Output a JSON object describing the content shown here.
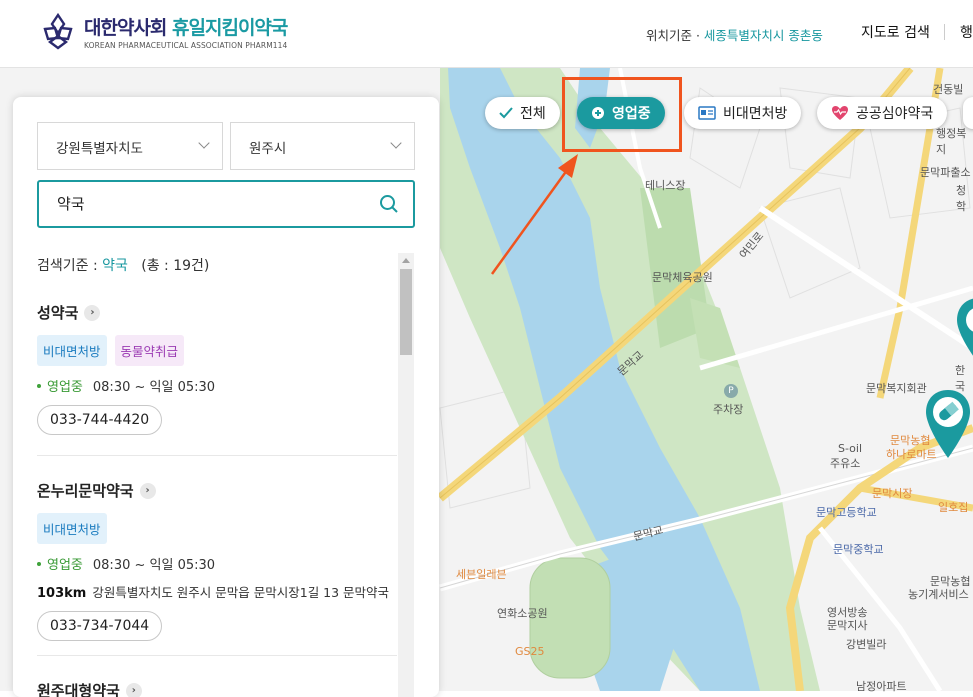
{
  "header": {
    "logo_title_main": "대한약사회",
    "logo_title_accent": "휴일지킴이약국",
    "logo_subtitle": "KOREAN PHARMACEUTICAL ASSOCIATION PHARM114",
    "location_prefix": "위치기준 · ",
    "location_value": "세종특별자치시 종촌동",
    "nav_map_search": "지도로 검색",
    "nav_more": "행"
  },
  "filters": [
    {
      "label": "전체",
      "icon": "check-icon",
      "active": false
    },
    {
      "label": "영업중",
      "icon": "plus-circle-icon",
      "active": true
    },
    {
      "label": "비대면처방",
      "icon": "id-card-icon",
      "active": false
    },
    {
      "label": "공공심야약국",
      "icon": "heart-pulse-icon",
      "active": false
    }
  ],
  "panel": {
    "province": "강원특별자치도",
    "city": "원주시",
    "search_value": "약국",
    "criteria_prefix": "검색기준 : ",
    "criteria_keyword": "약국",
    "criteria_count": "(총 : 19건)"
  },
  "pharmacies": [
    {
      "name": "성약국",
      "tags": [
        "비대면처방",
        "동물약취급"
      ],
      "status": "영업중",
      "hours": "08:30 ~ 익일 05:30",
      "distance": "",
      "address": "",
      "phone": "033-744-4420"
    },
    {
      "name": "온누리문막약국",
      "tags": [
        "비대면처방"
      ],
      "status": "영업중",
      "hours": "08:30 ~ 익일 05:30",
      "distance": "103km",
      "address": "강원특별자치도 원주시 문막읍 문막시장1길 13 문막약국",
      "phone": "033-734-7044"
    },
    {
      "name": "원주대형약국",
      "tags": [],
      "status": "",
      "hours": "",
      "distance": "",
      "address": "",
      "phone": ""
    }
  ],
  "map_labels": {
    "tennis": "테니스장",
    "park": "문막체육공원",
    "parking": "주차장",
    "bridge1": "문막교",
    "bridge2": "문막교",
    "road": "여민로",
    "welfare": "문막복지회관",
    "nonghyup": "문막농협",
    "hana": "하나로마트",
    "soil": "S-oil",
    "gas": "주유소",
    "market": "문막시장",
    "highschool": "문막고등학교",
    "middleschool": "문막중학교",
    "ilho": "일호집",
    "seven": "세븐일레븐",
    "yeonhwa": "연화소공원",
    "gs25": "GS25",
    "broadcast": "영서방송",
    "broadcast2": "문막지사",
    "gangbyeon": "강변빌라",
    "namjung": "남정아파트",
    "nonghyup2": "문막농협",
    "nongki": "농기계서비스",
    "geondong": "건동빌",
    "haengjeong": "행정복지",
    "culture": "문막파출소",
    "cheong": "청학",
    "han": "한국",
    "num25": "25"
  }
}
